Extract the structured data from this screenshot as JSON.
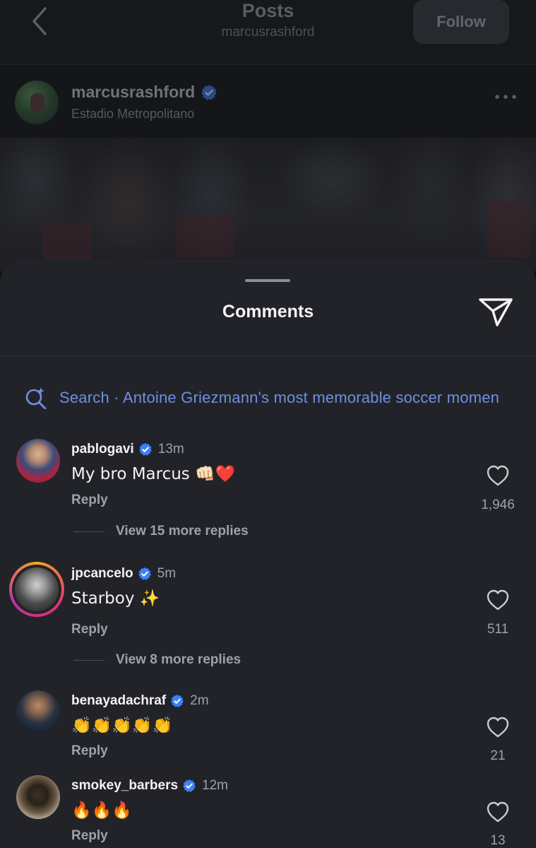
{
  "header": {
    "title": "Posts",
    "subtitle": "marcusrashford",
    "follow_label": "Follow"
  },
  "post": {
    "username": "marcusrashford",
    "location": "Estadio Metropolitano"
  },
  "sheet": {
    "title": "Comments",
    "search_text": "Search · Antoine Griezmann's most memorable soccer momen"
  },
  "comments": [
    {
      "username": "pablogavi",
      "time": "13m",
      "text": "My bro Marcus 👊🏻❤️",
      "reply_label": "Reply",
      "likes": "1,946",
      "view_replies": "View 15 more replies"
    },
    {
      "username": "jpcancelo",
      "time": "5m",
      "text": "Starboy ✨",
      "reply_label": "Reply",
      "likes": "511",
      "view_replies": "View 8 more replies"
    },
    {
      "username": "benayadachraf",
      "time": "2m",
      "text": "👏👏👏👏👏",
      "reply_label": "Reply",
      "likes": "21"
    },
    {
      "username": "smokey_barbers",
      "time": "12m",
      "text": "🔥🔥🔥",
      "reply_label": "Reply",
      "likes": "13"
    }
  ],
  "colors": {
    "verified": "#3b82f6",
    "link_blue": "#6f8fe0",
    "sheet_bg": "#212328"
  },
  "icons": {
    "back": "chevron-left-icon",
    "more": "more-dots-icon",
    "share": "send-icon",
    "search": "ai-search-icon",
    "verified": "verified-badge-icon",
    "like": "heart-icon"
  }
}
